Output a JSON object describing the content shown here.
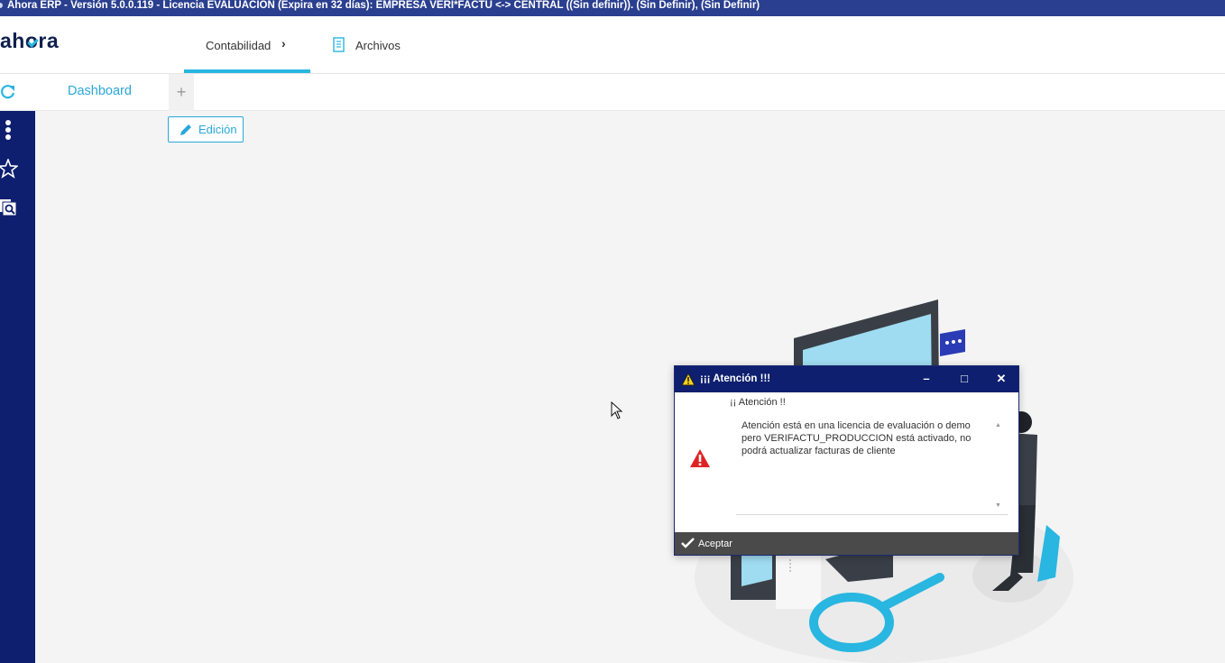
{
  "window": {
    "title": "Ahora ERP - Versión 5.0.0.119 - Licencia EVALUACIÓN (Expira en 32 días): EMPRESA VERI*FACTU <-> CENTRAL ((Sin definir)). (Sin Definir), (Sin Definir)"
  },
  "logo": {
    "text": "ahora"
  },
  "nav": {
    "tabs": [
      {
        "label": "Contabilidad",
        "active": true,
        "icon": "chevron-right-icon"
      },
      {
        "label": "Archivos",
        "active": false,
        "icon": "document-icon"
      }
    ]
  },
  "subbar": {
    "dashboard_label": "Dashboard",
    "add_tab_label": "+"
  },
  "toolbar": {
    "edit_label": "Edición"
  },
  "sidebar": {
    "icons": [
      "more-vertical-icon",
      "star-icon",
      "search-documents-icon"
    ]
  },
  "dialog": {
    "title": "¡¡¡ Atención !!!",
    "heading": "¡¡ Atención !!",
    "message": "Atención está en una licencia de evaluación o demo pero VERIFACTU_PRODUCCION está activado, no podrá actualizar facturas de cliente",
    "accept_label": "Aceptar"
  },
  "colors": {
    "accent": "#29b6e0",
    "sidebar": "#0d1f6e",
    "titlebar": "#2a3f8f"
  }
}
